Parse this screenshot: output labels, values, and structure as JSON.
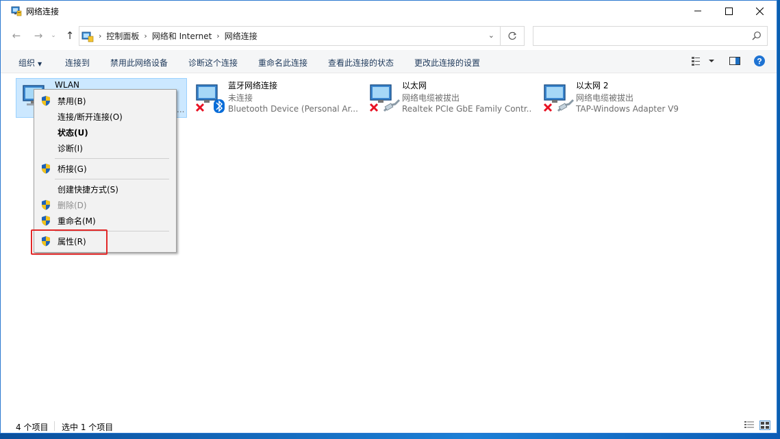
{
  "window": {
    "title": "网络连接",
    "controls": {
      "minimize": "minimize-icon",
      "maximize": "maximize-icon",
      "close": "close-icon"
    }
  },
  "address": {
    "crumbs": [
      "控制面板",
      "网络和 Internet",
      "网络连接"
    ],
    "search_placeholder": ""
  },
  "toolbar": {
    "organize": "组织",
    "connect_to": "连接到",
    "disable_device": "禁用此网络设备",
    "diagnose": "诊断这个连接",
    "rename": "重命名此连接",
    "view_status": "查看此连接的状态",
    "change_settings": "更改此连接的设置"
  },
  "connections": [
    {
      "name": "WLAN",
      "status": "",
      "device": "...",
      "selected": true
    },
    {
      "name": "蓝牙网络连接",
      "status": "未连接",
      "device": "Bluetooth Device (Personal Ar..."
    },
    {
      "name": "以太网",
      "status": "网络电缆被拔出",
      "device": "Realtek PCIe GbE Family Contr..."
    },
    {
      "name": "以太网 2",
      "status": "网络电缆被拔出",
      "device": "TAP-Windows Adapter V9"
    }
  ],
  "context_menu": {
    "disable": "禁用(B)",
    "connect_disconnect": "连接/断开连接(O)",
    "status": "状态(U)",
    "diagnose": "诊断(I)",
    "bridge": "桥接(G)",
    "create_shortcut": "创建快捷方式(S)",
    "delete": "删除(D)",
    "rename": "重命名(M)",
    "properties": "属性(R)"
  },
  "statusbar": {
    "count": "4 个项目",
    "selected": "选中 1 个项目"
  },
  "colors": {
    "accent": "#0063b1",
    "selection": "#cce8ff",
    "highlight_border": "#e22727",
    "error_x": "#e81123"
  }
}
